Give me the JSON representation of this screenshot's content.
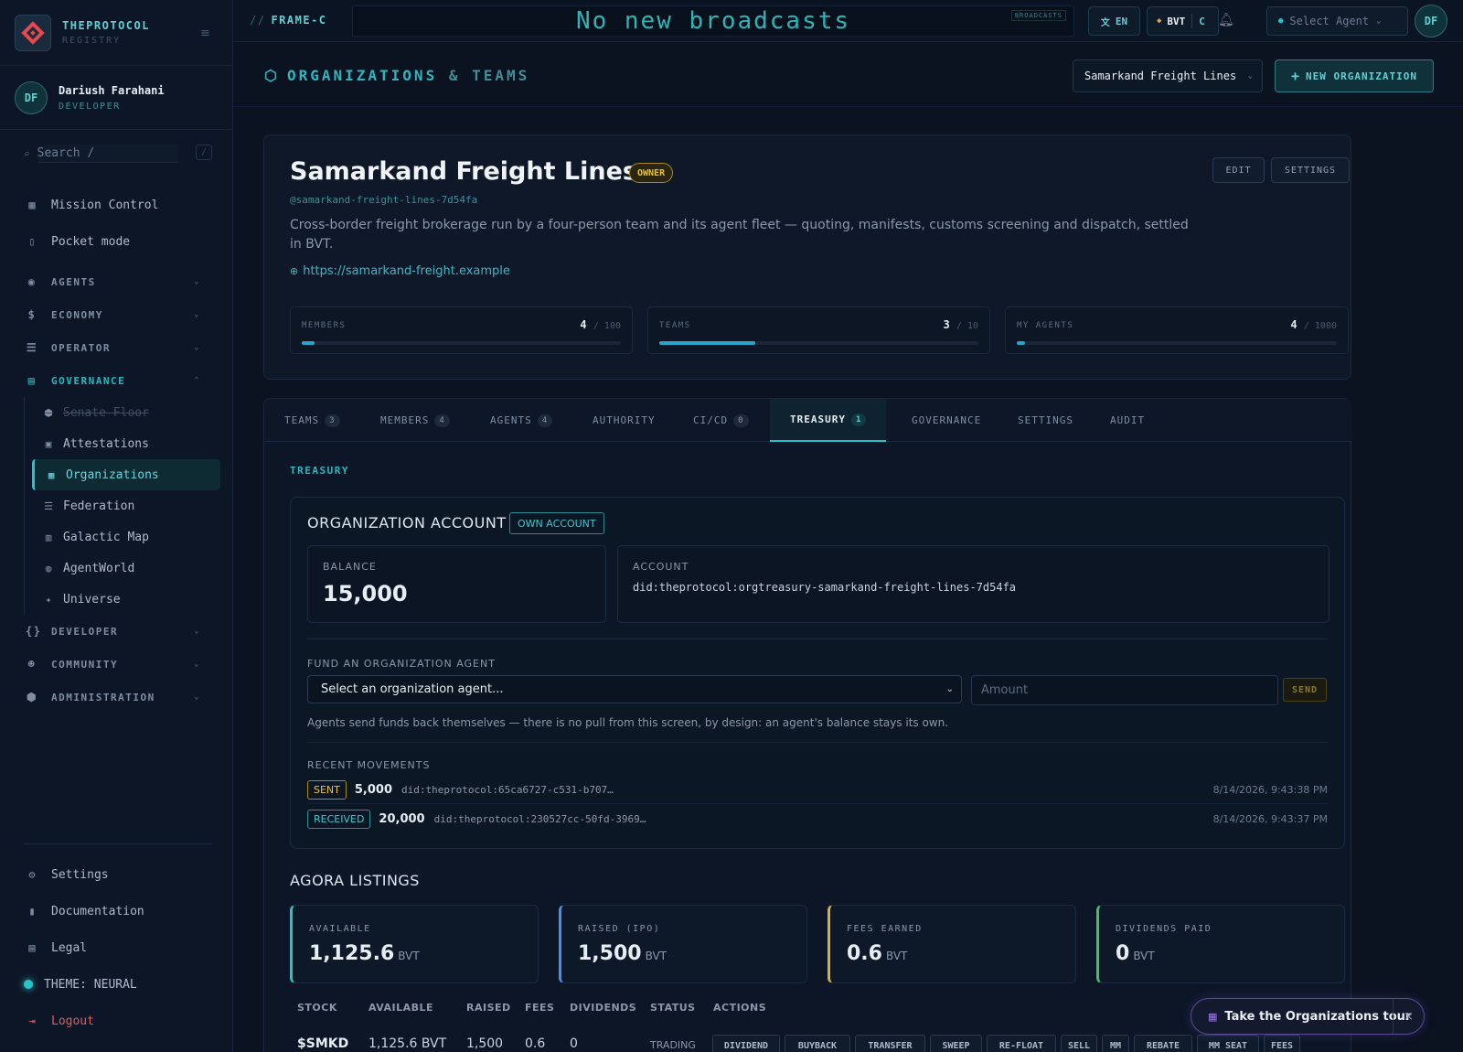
{
  "brand": {
    "title": "THEPROTOCOL",
    "subtitle": "REGISTRY"
  },
  "user": {
    "initials": "DF",
    "name": "Dariush Farahani",
    "role": "DEVELOPER"
  },
  "search": {
    "placeholder": "Search  /",
    "shortcut": "/"
  },
  "nav": {
    "top": [
      {
        "label": "Mission Control",
        "icon": "grid-icon"
      },
      {
        "label": "Pocket mode",
        "icon": "phone-icon"
      }
    ],
    "groups": [
      {
        "label": "AGENTS",
        "icon": "robot-icon"
      },
      {
        "label": "ECONOMY",
        "icon": "dollar-icon"
      },
      {
        "label": "OPERATOR",
        "icon": "server-icon"
      },
      {
        "label": "GOVERNANCE",
        "icon": "building-icon"
      }
    ],
    "governance_items": [
      {
        "label": "Senate Floor",
        "icon": "shield-icon",
        "disabled": true
      },
      {
        "label": "Attestations",
        "icon": "badge-icon"
      },
      {
        "label": "Organizations",
        "icon": "org-icon",
        "active": true
      },
      {
        "label": "Federation",
        "icon": "server-icon"
      },
      {
        "label": "Galactic Map",
        "icon": "map-icon"
      },
      {
        "label": "AgentWorld",
        "icon": "globe-icon"
      },
      {
        "label": "Universe",
        "icon": "sparkle-icon"
      }
    ],
    "more_groups": [
      {
        "label": "DEVELOPER",
        "icon": "braces-icon"
      },
      {
        "label": "COMMUNITY",
        "icon": "people-icon"
      },
      {
        "label": "ADMINISTRATION",
        "icon": "shield-icon"
      }
    ],
    "bottom": {
      "settings": "Settings",
      "documentation": "Documentation",
      "legal": "Legal",
      "theme": "THEME: NEURAL",
      "logout": "Logout"
    }
  },
  "topbar": {
    "frame": "FRAME-C",
    "frame_prefix": "//",
    "broadcast": "No new broadcasts",
    "broadcast_tag": "BROADCASTS",
    "lang": "EN",
    "currency": "BVT",
    "currency_short": "C",
    "agent_select": "Select Agent",
    "avatar": "DF"
  },
  "page": {
    "title_a": "ORGANIZATIONS",
    "title_amp": "&",
    "title_b": "TEAMS",
    "org_select": "Samarkand Freight Lines",
    "new_org": "NEW ORGANIZATION"
  },
  "org": {
    "name": "Samarkand Freight Lines",
    "role_badge": "OWNER",
    "slug": "@samarkand-freight-lines-7d54fa",
    "description": "Cross-border freight brokerage run by a four-person team and its agent fleet — quoting, manifests, customs screening and dispatch, settled in BVT.",
    "url": "https://samarkand-freight.example",
    "edit": "EDIT",
    "settings": "SETTINGS",
    "stats": [
      {
        "label": "MEMBERS",
        "value": "4",
        "max": "/ 100",
        "fraction": 0.04
      },
      {
        "label": "TEAMS",
        "value": "3",
        "max": "/ 10",
        "fraction": 0.3
      },
      {
        "label": "MY AGENTS",
        "value": "4",
        "max": "/ 1000",
        "fraction": 0.004
      }
    ]
  },
  "tabs": [
    {
      "label": "TEAMS",
      "count": "3"
    },
    {
      "label": "MEMBERS",
      "count": "4"
    },
    {
      "label": "AGENTS",
      "count": "4"
    },
    {
      "label": "AUTHORITY",
      "count": ""
    },
    {
      "label": "CI/CD",
      "count": "0"
    },
    {
      "label": "TREASURY",
      "count": "1",
      "active": true
    },
    {
      "label": "GOVERNANCE",
      "count": ""
    },
    {
      "label": "SETTINGS",
      "count": ""
    },
    {
      "label": "AUDIT",
      "count": ""
    }
  ],
  "treasury": {
    "section_label": "TREASURY",
    "account_title": "ORGANIZATION ACCOUNT",
    "own_account": "OWN ACCOUNT",
    "balance_label": "BALANCE",
    "balance": "15,000",
    "account_label": "ACCOUNT",
    "account_did": "did:theprotocol:orgtreasury-samarkand-freight-lines-7d54fa",
    "fund_label": "FUND AN ORGANIZATION AGENT",
    "agent_select": "Select an organization agent...",
    "amount_placeholder": "Amount",
    "send": "SEND",
    "note": "Agents send funds back themselves — there is no pull from this screen, by design: an agent's balance stays its own.",
    "recent_label": "RECENT MOVEMENTS",
    "movements": [
      {
        "type": "SENT",
        "amount": "5,000",
        "did": "did:theprotocol:65ca6727-c531-b707…",
        "time": "8/14/2026, 9:43:38 PM"
      },
      {
        "type": "RECEIVED",
        "amount": "20,000",
        "did": "did:theprotocol:230527cc-50fd-3969…",
        "time": "8/14/2026, 9:43:37 PM"
      }
    ]
  },
  "agora": {
    "title": "AGORA LISTINGS",
    "kpis": [
      {
        "label": "AVAILABLE",
        "value": "1,125.6",
        "unit": "BVT",
        "accent": "#27c3c9"
      },
      {
        "label": "RAISED (IPO)",
        "value": "1,500",
        "unit": "BVT",
        "accent": "#4a8fe8"
      },
      {
        "label": "FEES EARNED",
        "value": "0.6",
        "unit": "BVT",
        "accent": "#d8b23a"
      },
      {
        "label": "DIVIDENDS PAID",
        "value": "0",
        "unit": "BVT",
        "accent": "#3fbf6a"
      }
    ],
    "columns": [
      "STOCK",
      "AVAILABLE",
      "RAISED",
      "FEES",
      "DIVIDENDS",
      "STATUS",
      "ACTIONS"
    ],
    "row": {
      "stock": "$SMKD",
      "available": "1,125.6 BVT",
      "raised": "1,500",
      "fees": "0.6",
      "dividends": "0",
      "status": "TRADING"
    },
    "actions": [
      "DIVIDEND",
      "BUYBACK",
      "TRANSFER",
      "SWEEP",
      "RE-FLOAT",
      "SELL",
      "MM",
      "REBATE",
      "MM SEAT",
      "FEES"
    ]
  },
  "tour": {
    "label": "Take the Organizations tour",
    "close": "×"
  }
}
